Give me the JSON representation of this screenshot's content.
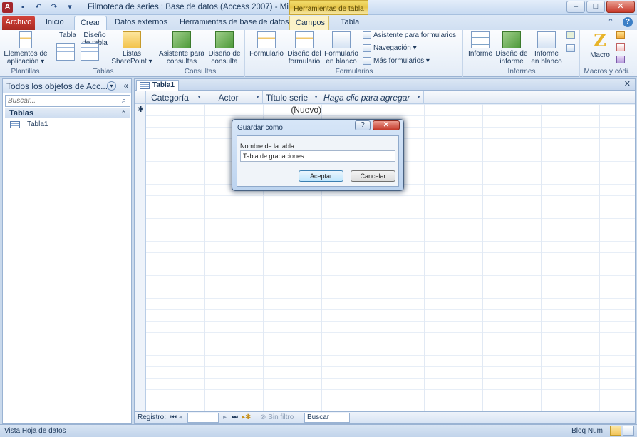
{
  "window": {
    "title": "Filmoteca de series : Base de datos (Access 2007) - Micro...",
    "context_header": "Herramientas de tabla",
    "app_icon": "A"
  },
  "quick_access": [
    "save-icon",
    "undo-icon",
    "redo-icon",
    "customize-icon"
  ],
  "tabs": {
    "archivo": "Archivo",
    "inicio": "Inicio",
    "crear": "Crear",
    "datos_externos": "Datos externos",
    "herramientas_bd": "Herramientas de base de datos",
    "campos": "Campos",
    "tabla": "Tabla"
  },
  "ribbon": {
    "plantillas": {
      "label": "Plantillas",
      "elementos_line1": "Elementos de",
      "elementos_line2": "aplicación ▾"
    },
    "tablas": {
      "label": "Tablas",
      "tabla": "Tabla",
      "diseno_line1": "Diseño",
      "diseno_line2": "de tabla",
      "listas_line1": "Listas",
      "listas_line2": "SharePoint ▾"
    },
    "consultas": {
      "label": "Consultas",
      "asistente_line1": "Asistente para",
      "asistente_line2": "consultas",
      "diseno_line1": "Diseño de",
      "diseno_line2": "consulta"
    },
    "formularios": {
      "label": "Formularios",
      "formulario": "Formulario",
      "diseno_line1": "Diseño del",
      "diseno_line2": "formulario",
      "blanco_line1": "Formulario",
      "blanco_line2": "en blanco",
      "asistente": "Asistente para formularios",
      "navegacion": "Navegación ▾",
      "mas": "Más formularios ▾"
    },
    "informes": {
      "label": "Informes",
      "informe": "Informe",
      "diseno_line1": "Diseño de",
      "diseno_line2": "informe",
      "blanco_line1": "Informe",
      "blanco_line2": "en blanco"
    },
    "macros": {
      "label": "Macros y códi...",
      "macro": "Macro"
    }
  },
  "navpane": {
    "title": "Todos los objetos de Acc...",
    "search_placeholder": "Buscar...",
    "group": "Tablas",
    "items": [
      {
        "label": "Tabla1"
      }
    ]
  },
  "document": {
    "tab": "Tabla1",
    "columns": [
      {
        "label": "Categoría"
      },
      {
        "label": "Actor"
      },
      {
        "label": "Título serie"
      },
      {
        "label": "Haga clic para agregar"
      }
    ],
    "new_row_marker": "✱",
    "new_row_value": "(Nuevo)"
  },
  "record_nav": {
    "label": "Registro:",
    "first": "⏮",
    "prev": "◂",
    "next": "▸",
    "last": "⏭",
    "new": "▸✱",
    "filter": "Sin filtro",
    "search": "Buscar"
  },
  "status": {
    "left": "Vista Hoja de datos",
    "right": "Bloq Num"
  },
  "dialog": {
    "title": "Guardar como",
    "help": "?",
    "close": "✕",
    "label": "Nombre de la tabla:",
    "value": "Tabla de grabaciones",
    "accept": "Aceptar",
    "cancel": "Cancelar"
  }
}
